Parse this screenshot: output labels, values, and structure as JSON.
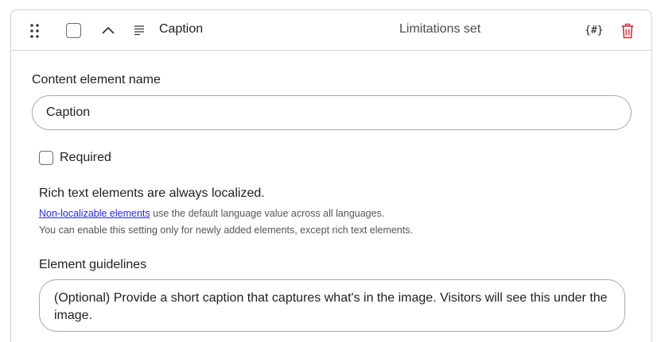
{
  "header": {
    "element_name": "Caption",
    "limitations": "Limitations set",
    "codename_icon_text": "{#}"
  },
  "icons": {
    "drag": "drag-handle-icon",
    "collapse": "chevron-up-icon",
    "type": "rich-text-icon",
    "codename": "codename-icon",
    "delete": "trash-icon"
  },
  "colors": {
    "delete": "#d1313d",
    "link": "#2a2acb",
    "border": "#d4d4d4"
  },
  "form": {
    "name_label": "Content element name",
    "name_value": "Caption",
    "required_label": "Required",
    "required_checked": false,
    "localized_title": "Rich text elements are always localized.",
    "localizable_link": "Non-localizable elements",
    "localizable_rest": " use the default language value across all languages.",
    "localizable_note": "You can enable this setting only for newly added elements, except rich text elements.",
    "guidelines_label": "Element guidelines",
    "guidelines_value": "(Optional) Provide a short caption that captures what's in the image. Visitors will see this under the image."
  }
}
